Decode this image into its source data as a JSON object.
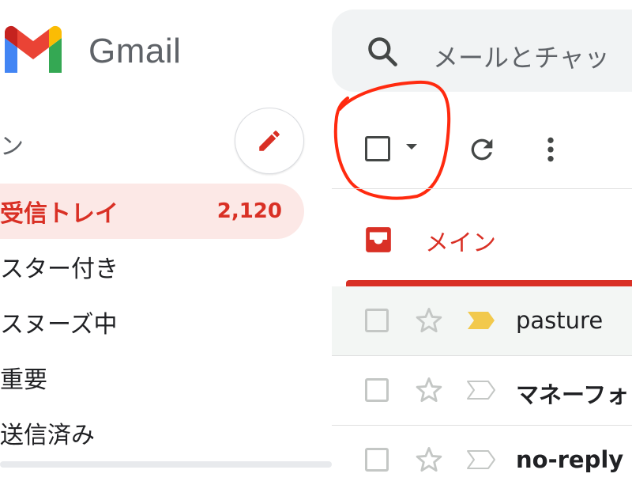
{
  "app": {
    "brand": "Gmail",
    "colors": {
      "accent": "#d93025",
      "gray": "#5f6368",
      "important": "#f2c94c",
      "annotation": "#ff2a0f"
    }
  },
  "sidebar": {
    "compose_stub": "ン",
    "compose_icon": "pencil-icon",
    "items": [
      {
        "label": "受信トレイ",
        "count": "2,120",
        "active": true
      },
      {
        "label": "スター付き"
      },
      {
        "label": "スヌーズ中"
      },
      {
        "label": "重要"
      },
      {
        "label": "送信済み"
      }
    ]
  },
  "search": {
    "placeholder": "メールとチャッ"
  },
  "toolbar": {
    "select_icon": "checkbox-icon",
    "caret_icon": "chevron-down-icon",
    "refresh_icon": "refresh-icon",
    "more_icon": "more-vert-icon"
  },
  "tabs": [
    {
      "label": "メイン",
      "icon": "inbox-icon",
      "active": true
    }
  ],
  "messages": [
    {
      "sender": "pasture",
      "unread": false,
      "important": true
    },
    {
      "sender": "マネーフォ",
      "unread": true,
      "important": false
    },
    {
      "sender": "no-reply",
      "unread": true,
      "important": false
    }
  ]
}
